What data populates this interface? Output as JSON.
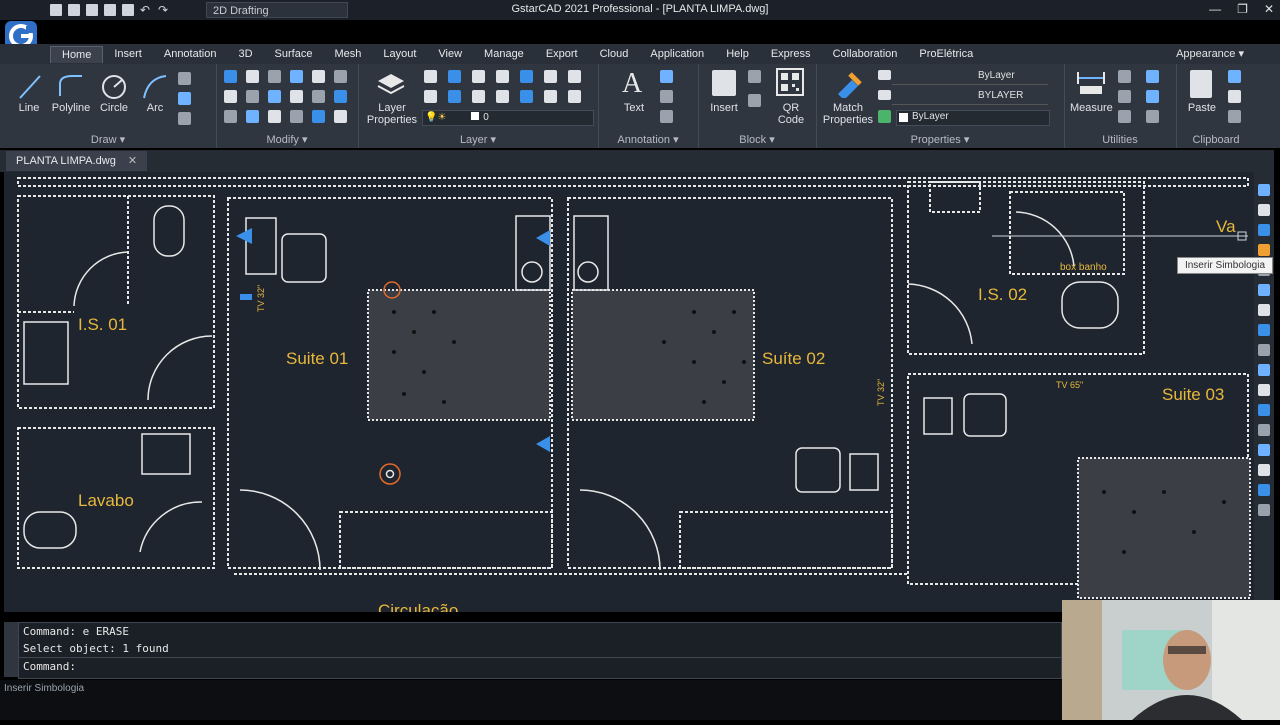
{
  "window": {
    "title": "GstarCAD 2021 Professional - [PLANTA LIMPA.dwg]",
    "workspace": "2D Drafting",
    "controls": [
      "—",
      "❐",
      "✕"
    ]
  },
  "menu": {
    "tabs": [
      "Home",
      "Insert",
      "Annotation",
      "3D",
      "Surface",
      "Mesh",
      "Layout",
      "View",
      "Manage",
      "Export",
      "Cloud",
      "Application",
      "Help",
      "Express",
      "Collaboration",
      "ProElétrica"
    ],
    "active": "Home",
    "appearance": "Appearance"
  },
  "ribbon": {
    "draw": {
      "title": "Draw",
      "tools": [
        "Line",
        "Polyline",
        "Circle",
        "Arc"
      ]
    },
    "modify": {
      "title": "Modify"
    },
    "layer": {
      "title": "Layer",
      "layer_properties": "Layer Properties",
      "current_layer": "0"
    },
    "annotation": {
      "title": "Annotation",
      "text": "Text"
    },
    "block": {
      "title": "Block",
      "insert": "Insert",
      "qr": "QR Code"
    },
    "properties": {
      "title": "Properties",
      "match": "Match Properties",
      "color": "ByLayer",
      "linetype": "ByLayer",
      "lineweight": "BYLAYER"
    },
    "utilities": {
      "title": "Utilities",
      "measure": "Measure"
    },
    "clipboard": {
      "title": "Clipboard",
      "paste": "Paste"
    }
  },
  "document": {
    "tab": "PLANTA LIMPA.dwg"
  },
  "drawing": {
    "labels": [
      "I.S. 01",
      "Suite 01",
      "Suíte 02",
      "I.S. 02",
      "Suite 03",
      "Lavabo",
      "Circulação",
      "Va"
    ],
    "small_labels": [
      "box banho",
      "TV 32\"",
      "TV 65\"",
      "TV 32\""
    ],
    "colors": {
      "label": "#e8b83c",
      "wall": "#e8e8e8",
      "background": "#1f252e",
      "blue": "#3a8fe8"
    }
  },
  "tooltip": "Inserir Simbologia",
  "command": {
    "lines": [
      "Command: e ERASE",
      "Select object:  1 found"
    ],
    "prompt": "Command:"
  },
  "status": {
    "text": "Inserir Simbologia"
  }
}
